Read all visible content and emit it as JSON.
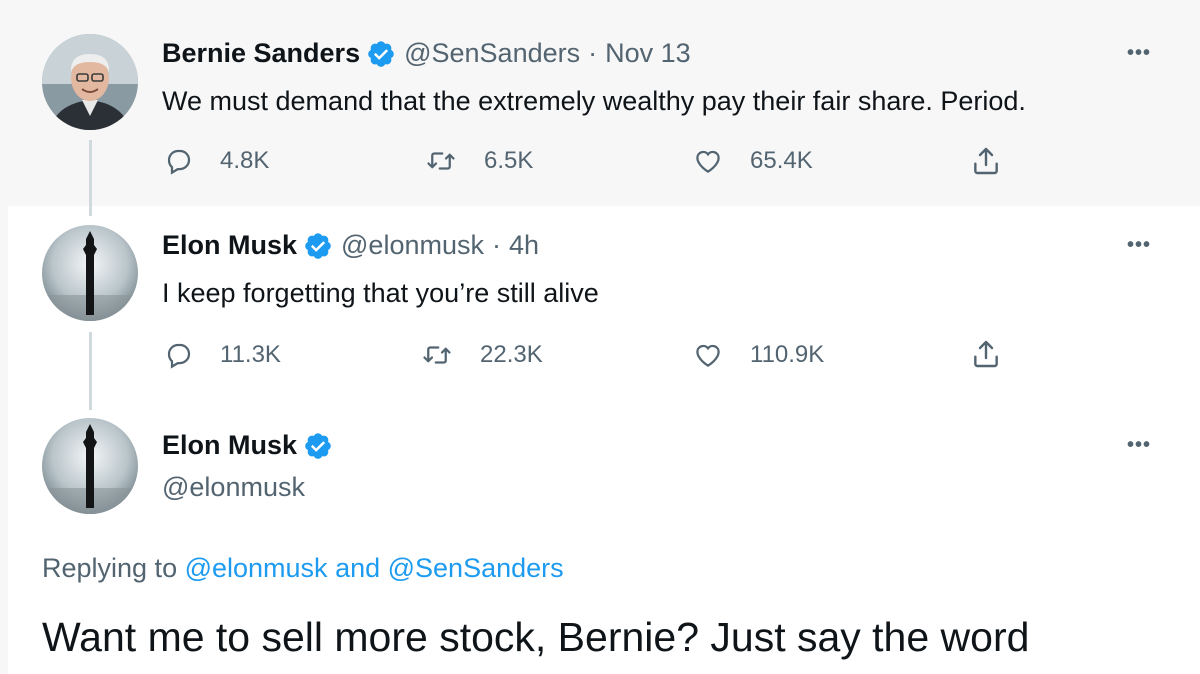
{
  "thread": {
    "tweets": [
      {
        "name": "Bernie Sanders",
        "handle": "@SenSanders",
        "separator": "·",
        "time": "Nov 13",
        "text": "We must demand that the extremely wealthy pay their fair share. Period.",
        "actions": {
          "replies": "4.8K",
          "retweets": "6.5K",
          "likes": "65.4K"
        }
      },
      {
        "name": "Elon Musk",
        "handle": "@elonmusk",
        "separator": "·",
        "time": "4h",
        "text": "I keep forgetting that you’re still alive",
        "actions": {
          "replies": "11.3K",
          "retweets": "22.3K",
          "likes": "110.9K"
        }
      }
    ],
    "main_tweet": {
      "name": "Elon Musk",
      "handle": "@elonmusk",
      "replying_prefix": "Replying to ",
      "replying_user1": "@elonmusk",
      "replying_and": " and ",
      "replying_user2": "@SenSanders",
      "text": "Want me to sell more stock, Bernie? Just say the word"
    }
  },
  "more_icon": "•••",
  "icons": [
    "verified-badge-icon",
    "reply-icon",
    "retweet-icon",
    "like-icon",
    "share-icon",
    "more-icon"
  ],
  "colors": {
    "verified": "#1d9bf0",
    "secondary_text": "#536471",
    "link": "#1d9bf0",
    "highlight_bg": "#f7f7f7"
  }
}
